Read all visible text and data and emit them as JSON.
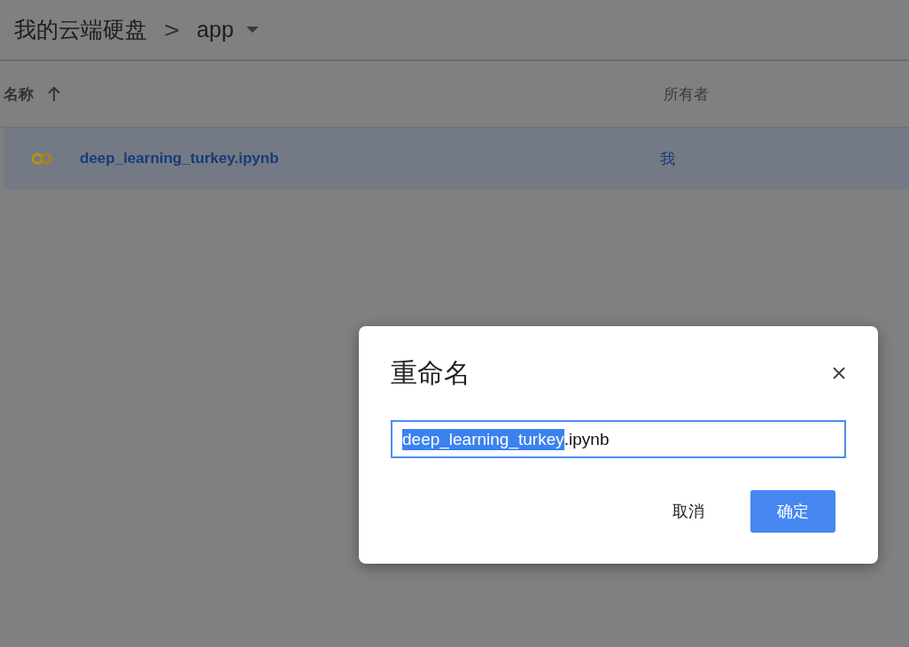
{
  "breadcrumb": {
    "root": "我的云端硬盘",
    "separator": ">",
    "current": "app"
  },
  "table": {
    "columns": [
      {
        "label": "名称",
        "sort_ascending": true
      },
      {
        "label": "所有者"
      }
    ],
    "rows": [
      {
        "name": "deep_learning_turkey.ipynb",
        "owner": "我",
        "selected": true
      }
    ]
  },
  "dialog": {
    "title": "重命名",
    "field": {
      "selected_text": "deep_learning_turkey",
      "rest_text": ".ipynb"
    },
    "buttons": [
      {
        "label": "取消",
        "kind": "text"
      },
      {
        "label": "确定",
        "kind": "primary"
      }
    ]
  }
}
